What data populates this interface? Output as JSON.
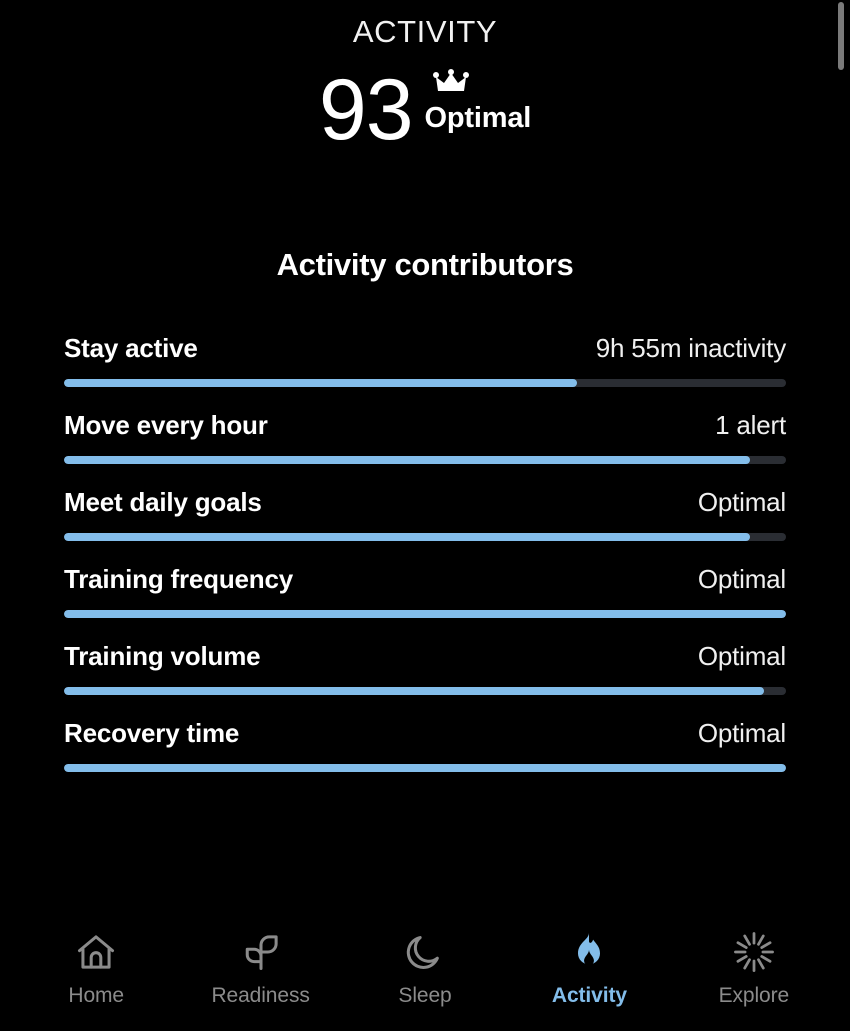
{
  "header": {
    "page_title": "ACTIVITY",
    "score": "93",
    "score_label": "Optimal",
    "crown_icon": "crown-icon"
  },
  "section": {
    "title": "Activity contributors"
  },
  "contributors": [
    {
      "name": "Stay active",
      "value": "9h 55m inactivity",
      "percent": 71
    },
    {
      "name": "Move every hour",
      "value": "1 alert",
      "percent": 95
    },
    {
      "name": "Meet daily goals",
      "value": "Optimal",
      "percent": 95
    },
    {
      "name": "Training frequency",
      "value": "Optimal",
      "percent": 100
    },
    {
      "name": "Training volume",
      "value": "Optimal",
      "percent": 97
    },
    {
      "name": "Recovery time",
      "value": "Optimal",
      "percent": 100
    }
  ],
  "bottom_nav": {
    "items": [
      {
        "label": "Home",
        "icon": "home-icon",
        "active": false
      },
      {
        "label": "Readiness",
        "icon": "sprout-icon",
        "active": false
      },
      {
        "label": "Sleep",
        "icon": "moon-icon",
        "active": false
      },
      {
        "label": "Activity",
        "icon": "flame-icon",
        "active": true
      },
      {
        "label": "Explore",
        "icon": "sunburst-icon",
        "active": false
      }
    ]
  },
  "colors": {
    "background": "#000000",
    "accent_blue": "#83bdea",
    "bar_track": "#2a2d33",
    "inactive_nav": "#8b8b8b",
    "text_primary": "#ffffff"
  },
  "chart_data": {
    "type": "bar",
    "title": "Activity contributors",
    "categories": [
      "Stay active",
      "Move every hour",
      "Meet daily goals",
      "Training frequency",
      "Training volume",
      "Recovery time"
    ],
    "values": [
      71,
      95,
      95,
      100,
      97,
      100
    ],
    "value_labels": [
      "9h 55m inactivity",
      "1 alert",
      "Optimal",
      "Optimal",
      "Optimal",
      "Optimal"
    ],
    "xlabel": "",
    "ylabel": "",
    "ylim": [
      0,
      100
    ],
    "grid": false,
    "legend": "none",
    "orientation": "horizontal"
  }
}
